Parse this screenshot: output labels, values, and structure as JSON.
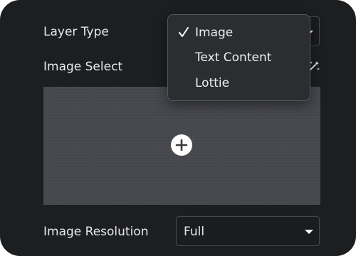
{
  "layer_type": {
    "label": "Layer Type",
    "selected": "Image",
    "options": [
      "Image",
      "Text Content",
      "Lottie"
    ]
  },
  "image_select": {
    "label": "Image Select",
    "magic_icon": "sparkle-wand-icon",
    "add_icon": "plus-circle-icon"
  },
  "image_resolution": {
    "label": "Image Resolution",
    "value": "Full",
    "icon": "caret-down-icon"
  },
  "icons": {
    "check": "checkmark-icon"
  },
  "colors": {
    "panel_background": "#1d1e20",
    "drop_zone": "#45474d",
    "menu_background": "#2c2d30",
    "text": "#e6e7e9"
  }
}
